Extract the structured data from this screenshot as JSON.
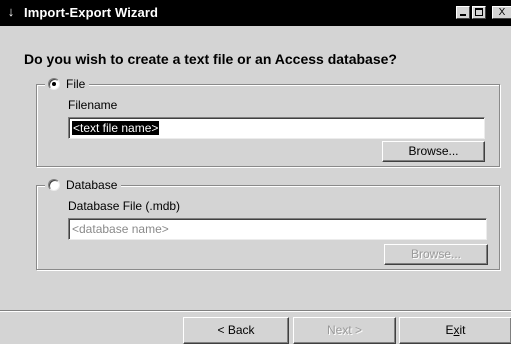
{
  "window": {
    "title_icon": "↓",
    "title": "Import-Export Wizard",
    "controls": {
      "minimize": "",
      "maximize": "",
      "close": "X"
    }
  },
  "question": "Do you wish to create a text file or an Access database?",
  "file_group": {
    "option_label": "File",
    "selected": true,
    "field_label": "Filename",
    "value": "<text file name>",
    "browse_label": "Browse..."
  },
  "database_group": {
    "option_label": "Database",
    "selected": false,
    "field_label": "Database File (.mdb)",
    "placeholder": "<database name>",
    "browse_label": "Browse..."
  },
  "footer": {
    "back_label": "< Back",
    "next_label": "Next >",
    "exit_label_prefix": "E",
    "exit_label_underlined": "x",
    "exit_label_suffix": "it"
  },
  "colors": {
    "titlebar_bg": "#000000",
    "dialog_bg": "#d4d4d4",
    "selection_bg": "#000000",
    "disabled_text": "#9a9a9a"
  }
}
